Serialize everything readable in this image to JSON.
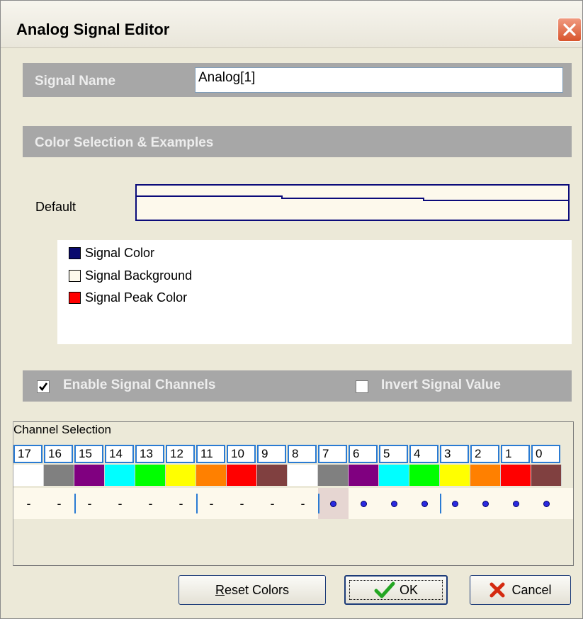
{
  "window": {
    "title": "Analog Signal Editor"
  },
  "signal_name": {
    "label": "Signal Name",
    "value": "Analog[1]"
  },
  "color_section": {
    "label": "Color Selection & Examples",
    "default_label": "Default"
  },
  "legend": [
    {
      "label": "Signal Color",
      "color": "#0a0a6e"
    },
    {
      "label": "Signal Background",
      "color": "#fdf9ec"
    },
    {
      "label": "Signal Peak Color",
      "color": "#ff0000"
    }
  ],
  "options": {
    "enable_channels": {
      "label": "Enable Signal Channels",
      "checked": true
    },
    "invert_value": {
      "label": "Invert  Signal Value",
      "checked": false
    }
  },
  "channels": {
    "title": "Channel Selection",
    "numbers": [
      "17",
      "16",
      "15",
      "14",
      "13",
      "12",
      "11",
      "10",
      "9",
      "8",
      "7",
      "6",
      "5",
      "4",
      "3",
      "2",
      "1",
      "0"
    ],
    "colors": [
      "#ffffff",
      "#808080",
      "#800080",
      "#00ffff",
      "#00ff00",
      "#ffff00",
      "#ff8000",
      "#ff0000",
      "#804040",
      "#ffffff",
      "#808080",
      "#800080",
      "#00ffff",
      "#00ff00",
      "#ffff00",
      "#ff8000",
      "#ff0000",
      "#804040"
    ],
    "states": [
      "-",
      "-",
      "-",
      "-",
      "-",
      "-",
      "-",
      "-",
      "-",
      "-",
      "dot",
      "dot",
      "dot",
      "dot",
      "dot",
      "dot",
      "dot",
      "dot"
    ]
  },
  "buttons": {
    "reset": {
      "first": "R",
      "rest": "eset Colors"
    },
    "ok": {
      "label": "OK"
    },
    "cancel": {
      "label": "Cancel"
    }
  }
}
